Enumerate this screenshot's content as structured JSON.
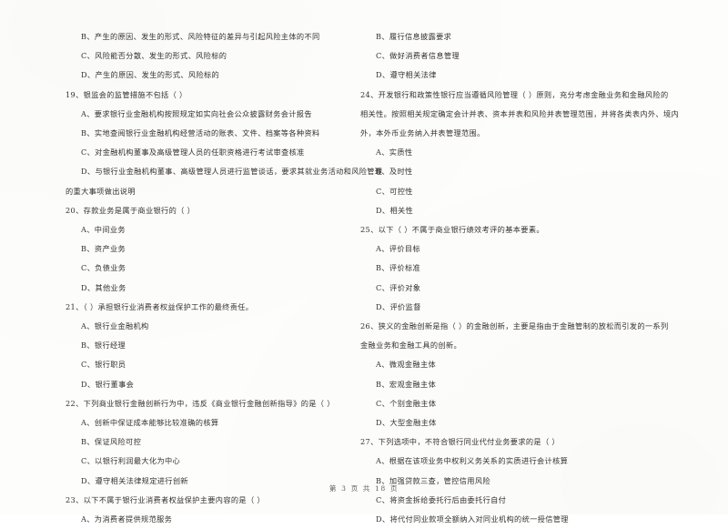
{
  "document": {
    "footer": "第 3 页 共 18 页"
  },
  "left_column": {
    "lines": [
      {
        "id": "q18-opt-b",
        "kind": "opt",
        "text": "B、产生的原因、发生的形式、风险特征的差异与引起风险主体的不同"
      },
      {
        "id": "q18-opt-c",
        "kind": "opt",
        "text": "C、风险能否分散、发生的形式、风险标的"
      },
      {
        "id": "q18-opt-d",
        "kind": "opt",
        "text": "D、产生的原因、发生的形式、风险标的"
      },
      {
        "id": "q19-stem",
        "kind": "stem",
        "text": "19、银监会的监管措施不包括（        ）"
      },
      {
        "id": "q19-opt-a",
        "kind": "opt",
        "text": "A、要求银行业金融机构按照规定如实向社会公众披露财务会计报告"
      },
      {
        "id": "q19-opt-b",
        "kind": "opt",
        "text": "B、实地查阅银行业金融机构经营活动的账表、文件、档案等各种资料"
      },
      {
        "id": "q19-opt-c",
        "kind": "opt",
        "text": "C、对金融机构董事及高级管理人员的任职资格进行考试审查核准"
      },
      {
        "id": "q19-opt-d",
        "kind": "opt",
        "text": "D、与银行业金融机构董事、高级管理人员进行监管谈话，要求其就业务活动和风险管理"
      },
      {
        "id": "q19-opt-d-cont",
        "kind": "cont",
        "text": "的重大事项做出说明"
      },
      {
        "id": "q20-stem",
        "kind": "stem",
        "text": "20、存款业务是属于商业银行的（        ）"
      },
      {
        "id": "q20-opt-a",
        "kind": "opt",
        "text": "A、中间业务"
      },
      {
        "id": "q20-opt-b",
        "kind": "opt",
        "text": "B、资产业务"
      },
      {
        "id": "q20-opt-c",
        "kind": "opt",
        "text": "C、负债业务"
      },
      {
        "id": "q20-opt-d",
        "kind": "opt",
        "text": "D、其他业务"
      },
      {
        "id": "q21-stem",
        "kind": "stem",
        "text": "21、（        ）承担银行业消费者权益保护工作的最终责任。"
      },
      {
        "id": "q21-opt-a",
        "kind": "opt",
        "text": "A、银行业金融机构"
      },
      {
        "id": "q21-opt-b",
        "kind": "opt",
        "text": "B、银行经理"
      },
      {
        "id": "q21-opt-c",
        "kind": "opt",
        "text": "C、银行职员"
      },
      {
        "id": "q21-opt-d",
        "kind": "opt",
        "text": "D、银行董事会"
      },
      {
        "id": "q22-stem",
        "kind": "stem",
        "text": "22、下列商业银行金融创新行为中，违反《商业银行金融创新指导》的是（        ）"
      },
      {
        "id": "q22-opt-a",
        "kind": "opt",
        "text": "A、创新中保证成本能够比较准确的核算"
      },
      {
        "id": "q22-opt-b",
        "kind": "opt",
        "text": "B、保证风险可控"
      },
      {
        "id": "q22-opt-c",
        "kind": "opt",
        "text": "C、以银行利润最大化为中心"
      },
      {
        "id": "q22-opt-d",
        "kind": "opt",
        "text": "D、遵守相关法律规定进行创新"
      },
      {
        "id": "q23-stem",
        "kind": "stem",
        "text": "23、以下不属于银行业消费者权益保护主要内容的是（        ）"
      },
      {
        "id": "q23-opt-a",
        "kind": "opt",
        "text": "A、为消费者提供规范服务"
      }
    ]
  },
  "right_column": {
    "lines": [
      {
        "id": "q23-opt-b",
        "kind": "opt",
        "text": "B、履行信息披露要求"
      },
      {
        "id": "q23-opt-c",
        "kind": "opt",
        "text": "C、做好消费者信息管理"
      },
      {
        "id": "q23-opt-d",
        "kind": "opt",
        "text": "D、遵守相关法律"
      },
      {
        "id": "q24-stem",
        "kind": "stem",
        "text": "24、开发银行和政策性银行应当遵循风险管理（        ）原则，充分考虑金融业务和金融风险的"
      },
      {
        "id": "q24-stem-cont1",
        "kind": "cont",
        "text": "相关性。按照相关规定确定会计并表、资本并表和风险并表管理范围，并将各类表内外、境内"
      },
      {
        "id": "q24-stem-cont2",
        "kind": "cont",
        "text": "外，本外币业务纳入并表管理范围。"
      },
      {
        "id": "q24-opt-a",
        "kind": "opt",
        "text": "A、实质性"
      },
      {
        "id": "q24-opt-b",
        "kind": "opt",
        "text": "B、及时性"
      },
      {
        "id": "q24-opt-c",
        "kind": "opt",
        "text": "C、可控性"
      },
      {
        "id": "q24-opt-d",
        "kind": "opt",
        "text": "D、相关性"
      },
      {
        "id": "q25-stem",
        "kind": "stem",
        "text": "25、以下（        ）不属于商业银行绩效考评的基本要素。"
      },
      {
        "id": "q25-opt-a",
        "kind": "opt",
        "text": "A、评价目标"
      },
      {
        "id": "q25-opt-b",
        "kind": "opt",
        "text": "B、评价标准"
      },
      {
        "id": "q25-opt-c",
        "kind": "opt",
        "text": "C、评价对象"
      },
      {
        "id": "q25-opt-d",
        "kind": "opt",
        "text": "D、评价监督"
      },
      {
        "id": "q26-stem",
        "kind": "stem",
        "text": "26、狭义的金融创新是指（        ）的金融创新，主要是指由于金融管制的放松而引发的一系列"
      },
      {
        "id": "q26-stem-cont",
        "kind": "cont",
        "text": "金融业务和金融工具的创新。"
      },
      {
        "id": "q26-opt-a",
        "kind": "opt",
        "text": "A、微观金融主体"
      },
      {
        "id": "q26-opt-b",
        "kind": "opt",
        "text": "B、宏观金融主体"
      },
      {
        "id": "q26-opt-c",
        "kind": "opt",
        "text": "C、个别金融主体"
      },
      {
        "id": "q26-opt-d",
        "kind": "opt",
        "text": "D、大型金融主体"
      },
      {
        "id": "q27-stem",
        "kind": "stem",
        "text": "27、下列选项中，不符合银行同业代付业务要求的是（        ）"
      },
      {
        "id": "q27-opt-a",
        "kind": "opt",
        "text": "A、根据在该项业务中权利义务关系的实质进行会计核算"
      },
      {
        "id": "q27-opt-b",
        "kind": "opt",
        "text": "B、加强贷款三查，管控信用风险"
      },
      {
        "id": "q27-opt-c",
        "kind": "opt",
        "text": "C、将资金拆给委托行后由委托行自付"
      },
      {
        "id": "q27-opt-d",
        "kind": "opt",
        "text": "D、将代付同业款项全额纳入对同业机构的统一授信管理"
      }
    ]
  }
}
